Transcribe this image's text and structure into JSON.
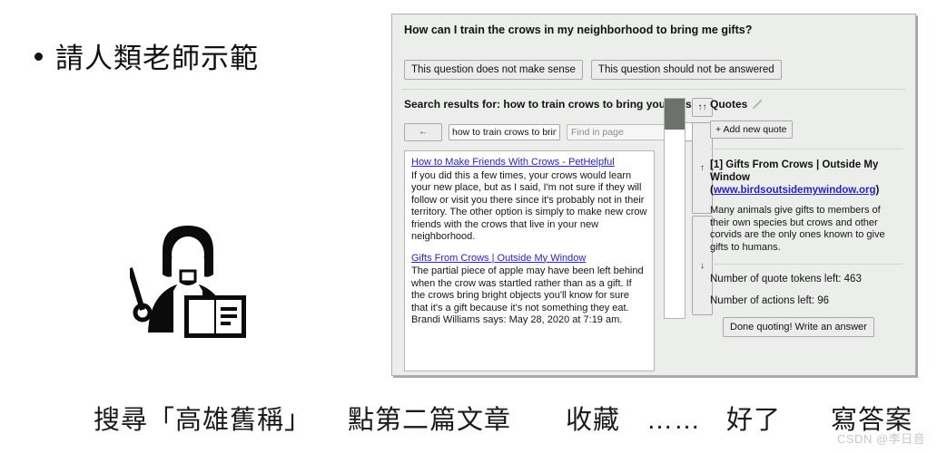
{
  "slide": {
    "bullet_text": "請人類老師示範",
    "illustration_name": "teacher-with-pointer-and-book",
    "captions": [
      "搜尋「高雄舊稱」",
      "點第二篇文章",
      "收藏",
      "……",
      "好了",
      "寫答案"
    ],
    "watermark": "CSDN @李日音"
  },
  "app": {
    "question": "How can I train the crows in my neighborhood to bring me gifts?",
    "reject_buttons": [
      "This question does not make sense",
      "This question should not be answered"
    ],
    "results": {
      "heading": "Search results for: how to train crows to bring you gifts",
      "back_button_label": "←",
      "query_value": "how to train crows to bring",
      "find_placeholder": "Find in page",
      "find_value": "",
      "items": [
        {
          "title": "How to Make Friends With Crows - PetHelpful",
          "snippet": "If you did this a few times, your crows would learn your new place, but as I said, I'm not sure if they will follow or visit you there since it's probably not in their territory. The other option is simply to make new crow friends with the crows that live in your new neighborhood."
        },
        {
          "title": "Gifts From Crows | Outside My Window",
          "snippet": "The partial piece of apple may have been left behind when the crow was startled rather than as a gift. If the crows bring bright objects you'll know for sure that it's a gift because it's not something they eat. Brandi Williams says: May 28, 2020 at 7:19 am."
        }
      ],
      "scroll_buttons": {
        "top": "↑↑",
        "up": "↑",
        "down": "↓"
      }
    },
    "quotes": {
      "heading": "Quotes",
      "heading_icon": "pencil-icon",
      "add_button": "+ Add new quote",
      "quote_index": "[1]",
      "quote_title": "Gifts From Crows | Outside My Window",
      "quote_url": "www.birdsoutsidemywindow.org",
      "quote_body": "Many animals give gifts to members of their own species but crows and other corvids are the only ones known to give gifts to humans.",
      "tokens_left": "Number of quote tokens left: 463",
      "actions_left": "Number of actions left: 96",
      "done_button": "Done quoting! Write an answer"
    }
  },
  "colors": {
    "panel_bg": "#eceeec",
    "link": "#2b22c9",
    "scrollbar_thumb": "#6e706e",
    "text": "#111111"
  }
}
